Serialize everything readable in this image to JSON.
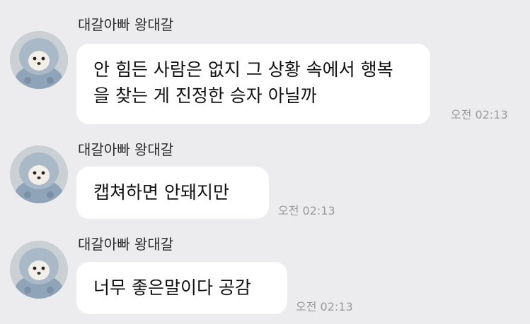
{
  "messages": [
    {
      "sender": "대갈아빠 왕대갈",
      "text": "안 힘든 사람은 없지 그 상황 속에서 행복을 찾는 게 진정한 승자 아닐까",
      "lines": [
        "안 힘든 사람은 없지 그 상황 속에서 행복",
        "을 찾는 게 진정한 승자 아닐까"
      ],
      "time": "오전 02:13",
      "avatar_icon": "dog-avatar-icon"
    },
    {
      "sender": "대갈아빠 왕대갈",
      "text": "캡쳐하면 안돼지만",
      "time": "오전 02:13",
      "avatar_icon": "dog-avatar-icon"
    },
    {
      "sender": "대갈아빠 왕대갈",
      "text": "너무 좋은말이다 공감",
      "time": "오전 02:13",
      "avatar_icon": "dog-avatar-icon"
    }
  ],
  "colors": {
    "background": "#ececee",
    "bubble": "#ffffff",
    "timestamp": "#9a9a9e"
  }
}
